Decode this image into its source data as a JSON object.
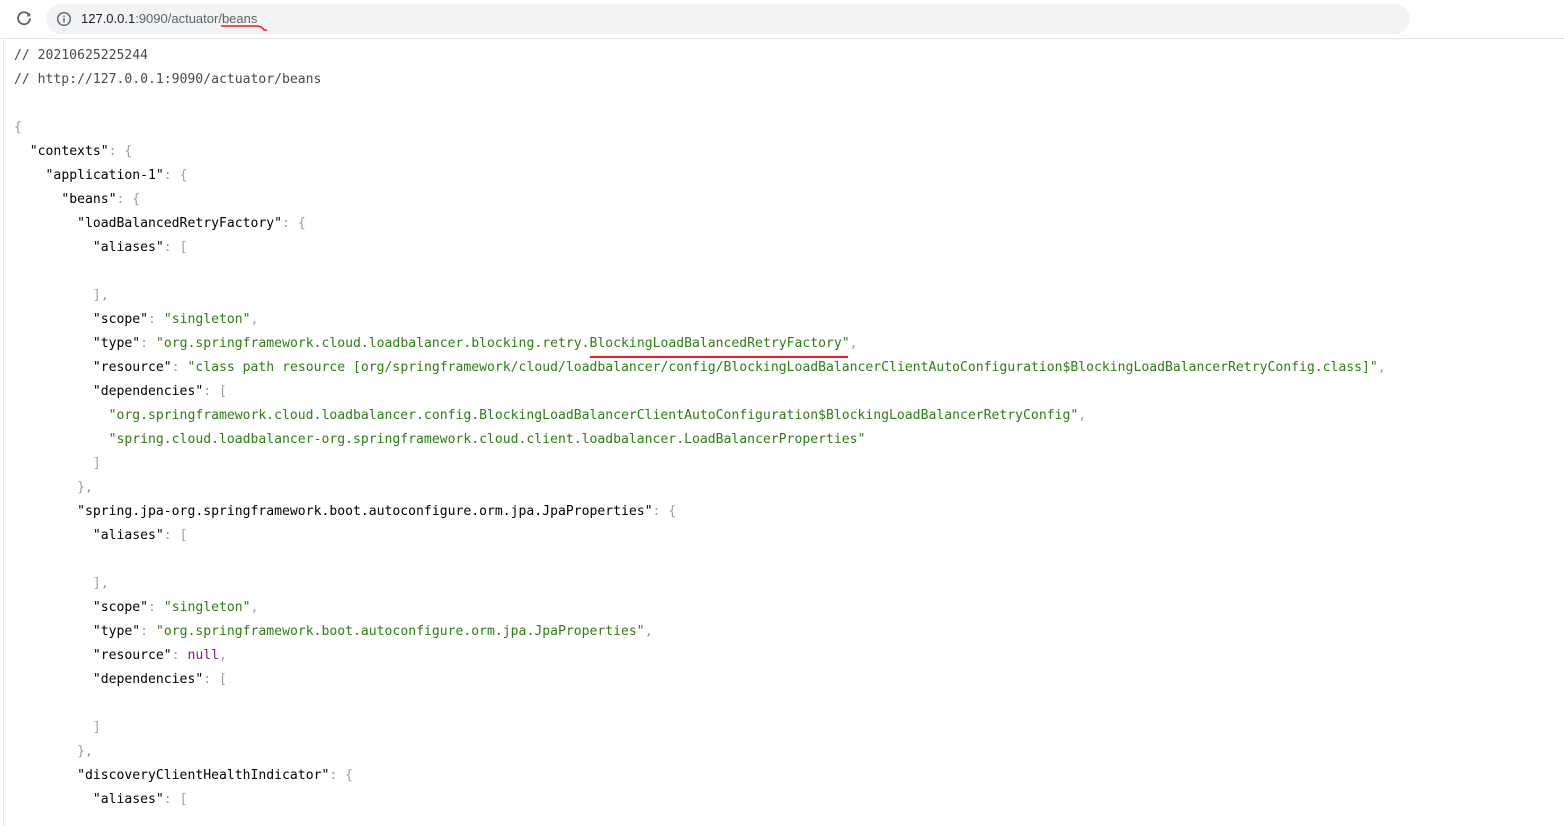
{
  "browser": {
    "url_host": "127.0.0.1",
    "url_rest": ":9090/actuator/",
    "url_highlight": "beans"
  },
  "comments": {
    "timestamp": "// 20210625225244",
    "source": "// http://127.0.0.1:9090/actuator/beans"
  },
  "json": {
    "contexts_key": "\"contexts\"",
    "application_key": "\"application-1\"",
    "beans_key": "\"beans\"",
    "bean1": {
      "name": "\"loadBalancedRetryFactory\"",
      "aliases_key": "\"aliases\"",
      "scope_key": "\"scope\"",
      "scope_value": "\"singleton\"",
      "type_key": "\"type\"",
      "type_prefix": "\"org.springframework.cloud.loadbalancer.blocking.retry.",
      "type_highlight": "BlockingLoadBalancedRetryFactory",
      "type_suffix": "\"",
      "resource_key": "\"resource\"",
      "resource_value": "\"class path resource [org/springframework/cloud/loadbalancer/config/BlockingLoadBalancerClientAutoConfiguration$BlockingLoadBalancerRetryConfig.class]\"",
      "dependencies_key": "\"dependencies\"",
      "dep_1": "\"org.springframework.cloud.loadbalancer.config.BlockingLoadBalancerClientAutoConfiguration$BlockingLoadBalancerRetryConfig\"",
      "dep_2": "\"spring.cloud.loadbalancer-org.springframework.cloud.client.loadbalancer.LoadBalancerProperties\""
    },
    "bean2": {
      "name": "\"spring.jpa-org.springframework.boot.autoconfigure.orm.jpa.JpaProperties\"",
      "aliases_key": "\"aliases\"",
      "scope_key": "\"scope\"",
      "scope_value": "\"singleton\"",
      "type_key": "\"type\"",
      "type_value": "\"org.springframework.boot.autoconfigure.orm.jpa.JpaProperties\"",
      "resource_key": "\"resource\"",
      "resource_value": "null",
      "dependencies_key": "\"dependencies\""
    },
    "bean3": {
      "name": "\"discoveryClientHealthIndicator\"",
      "aliases_key": "\"aliases\""
    }
  },
  "colors": {
    "string": "#2e7d15",
    "null": "#8a138a",
    "punctuation": "#9e9e9e",
    "annotation": "#e8201e"
  }
}
